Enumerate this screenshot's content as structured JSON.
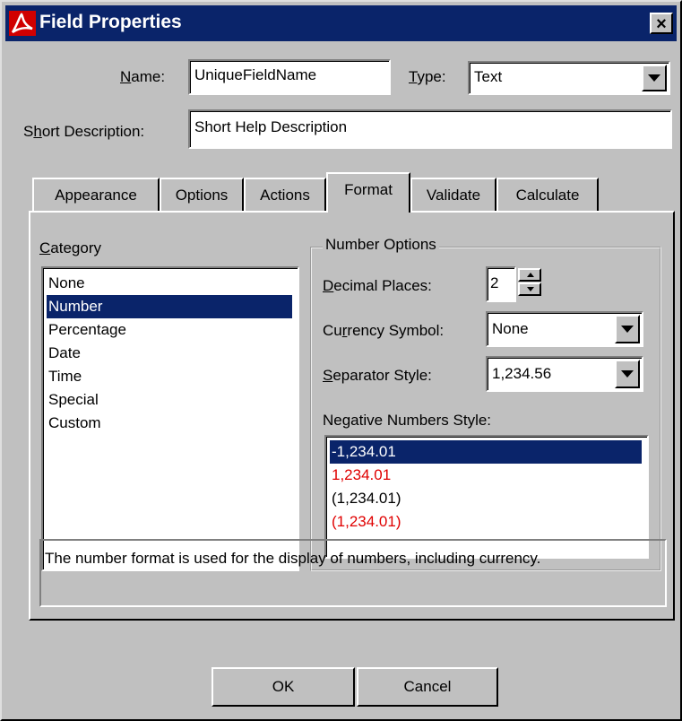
{
  "window": {
    "title": "Field Properties",
    "close_glyph": "×",
    "icon": "acrobat-icon"
  },
  "name_field": {
    "label_prefix": "",
    "label_underlined": "N",
    "label_rest": "ame:",
    "value": "UniqueFieldName"
  },
  "type_field": {
    "label_underlined": "T",
    "label_rest": "ype:",
    "value": "Text"
  },
  "short_description": {
    "label_start": "S",
    "label_underlined": "h",
    "label_rest": "ort Description:",
    "value": "Short Help Description"
  },
  "tabs": [
    {
      "label": "Appearance"
    },
    {
      "label": "Options"
    },
    {
      "label": "Actions"
    },
    {
      "label": "Format",
      "active": true
    },
    {
      "label": "Validate"
    },
    {
      "label": "Calculate"
    }
  ],
  "category": {
    "label_underlined": "C",
    "label_rest": "ategory",
    "items": [
      "None",
      "Number",
      "Percentage",
      "Date",
      "Time",
      "Special",
      "Custom"
    ],
    "selected": "Number"
  },
  "number_options": {
    "group_label": "Number Options",
    "decimal_places": {
      "label_underlined": "D",
      "label_rest": "ecimal Places:",
      "value": "2"
    },
    "currency_symbol": {
      "label_start": "Cu",
      "label_underlined": "r",
      "label_rest": "rency Symbol:",
      "value": "None"
    },
    "separator_style": {
      "label_underlined": "S",
      "label_rest": "eparator Style:",
      "value": "1,234.56"
    },
    "negative_numbers": {
      "label": "Negative Numbers Style:",
      "items": [
        "-1,234.01",
        "1,234.01",
        "(1,234.01)",
        "(1,234.01)"
      ],
      "item_colors": [
        "#ffffff",
        "#e00000",
        "#000000",
        "#e00000"
      ],
      "selected_index": 0
    }
  },
  "description": "The number format is used for the display of numbers, including currency.",
  "buttons": {
    "ok": "OK",
    "cancel": "Cancel"
  },
  "colors": {
    "title_bar": "#0a246a",
    "selection": "#0a246a",
    "face": "#c0c0c0",
    "negative_red": "#e00000"
  }
}
